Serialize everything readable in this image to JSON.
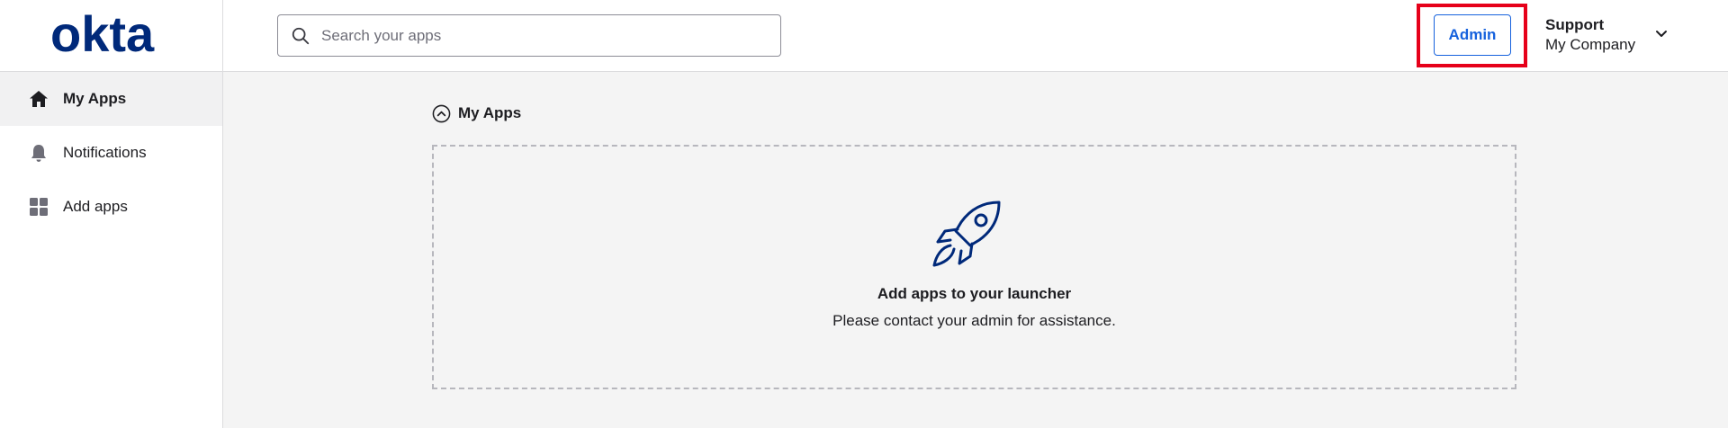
{
  "brand": {
    "logo_text": "okta",
    "color": "#00297a"
  },
  "header": {
    "search": {
      "placeholder": "Search your apps",
      "value": ""
    },
    "admin_label": "Admin",
    "user": {
      "name": "Support",
      "org": "My Company"
    }
  },
  "sidebar": {
    "items": [
      {
        "label": "My Apps",
        "icon": "home-icon",
        "active": true
      },
      {
        "label": "Notifications",
        "icon": "bell-icon",
        "active": false
      },
      {
        "label": "Add apps",
        "icon": "grid-icon",
        "active": false
      }
    ]
  },
  "main": {
    "section_title": "My Apps",
    "empty_state": {
      "title": "Add apps to your launcher",
      "subtitle": "Please contact your admin for assistance."
    }
  },
  "colors": {
    "accent": "#1662dd",
    "highlight": "#e6001a",
    "background": "#f4f4f4"
  }
}
